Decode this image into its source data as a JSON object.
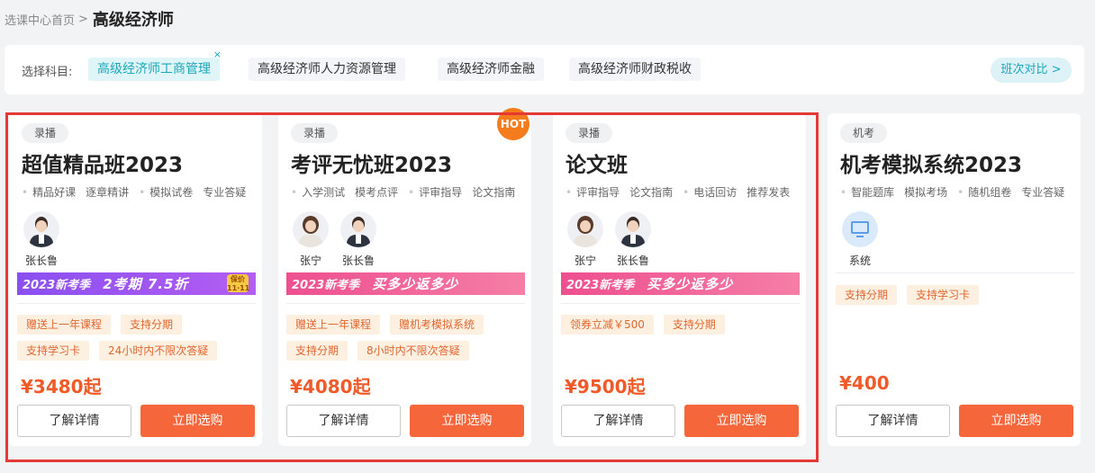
{
  "breadcrumb": {
    "parent": "选课中心首页",
    "separator": ">",
    "current": "高级经济师"
  },
  "subject_bar": {
    "label": "选择科目:",
    "subjects": [
      {
        "label": "高级经济师工商管理",
        "active": true
      },
      {
        "label": "高级经济师人力资源管理",
        "active": false
      },
      {
        "label": "高级经济师金融",
        "active": false
      },
      {
        "label": "高级经济师财政税收",
        "active": false
      }
    ],
    "close_glyph": "×",
    "compare_label": "班次对比 >"
  },
  "cards": [
    {
      "badge": "录播",
      "title": "超值精品班2023",
      "features": [
        "精品好课",
        "逐章精讲",
        "模拟试卷",
        "专业答疑"
      ],
      "teachers": [
        {
          "name": "张长鲁",
          "avatar": "male-teacher"
        }
      ],
      "banner": {
        "tag": "2023新考季",
        "main": "2考期  7.5折",
        "seal": "保价 11·11",
        "style": "purple"
      },
      "tags": [
        "赠送上一年课程",
        "支持分期",
        "支持学习卡",
        "24小时内不限次答疑"
      ],
      "price": "¥3480起",
      "detail_label": "了解详情",
      "buy_label": "立即选购"
    },
    {
      "badge": "录播",
      "hot": "HOT",
      "title": "考评无忧班2023",
      "features": [
        "入学测试",
        "模考点评",
        "评审指导",
        "论文指南"
      ],
      "teachers": [
        {
          "name": "张宁",
          "avatar": "female-teacher"
        },
        {
          "name": "张长鲁",
          "avatar": "male-teacher"
        }
      ],
      "banner": {
        "tag": "2023新考季",
        "main": "买多少返多少",
        "style": "pink"
      },
      "tags": [
        "赠送上一年课程",
        "赠机考模拟系统",
        "支持分期",
        "8小时内不限次答疑"
      ],
      "price": "¥4080起",
      "detail_label": "了解详情",
      "buy_label": "立即选购"
    },
    {
      "badge": "录播",
      "title": "论文班",
      "features": [
        "评审指导",
        "论文指南",
        "电话回访",
        "推荐发表"
      ],
      "teachers": [
        {
          "name": "张宁",
          "avatar": "female-teacher"
        },
        {
          "name": "张长鲁",
          "avatar": "male-teacher"
        }
      ],
      "banner": {
        "tag": "2023新考季",
        "main": "买多少返多少",
        "style": "pink"
      },
      "tags": [
        "领券立减￥500",
        "支持分期"
      ],
      "price": "¥9500起",
      "detail_label": "了解详情",
      "buy_label": "立即选购"
    },
    {
      "badge": "机考",
      "title": "机考模拟系统2023",
      "features": [
        "智能题库",
        "模拟考场",
        "随机组卷",
        "专业答疑"
      ],
      "teachers": [
        {
          "name": "系统",
          "avatar": "monitor-icon"
        }
      ],
      "tags": [
        "支持分期",
        "支持学习卡"
      ],
      "price": "¥400",
      "detail_label": "了解详情",
      "buy_label": "立即选购"
    }
  ],
  "colors": {
    "accent": "#1ba7b9",
    "price": "#f05a28",
    "buy_button": "#f5663a",
    "highlight_border": "#e53935"
  }
}
